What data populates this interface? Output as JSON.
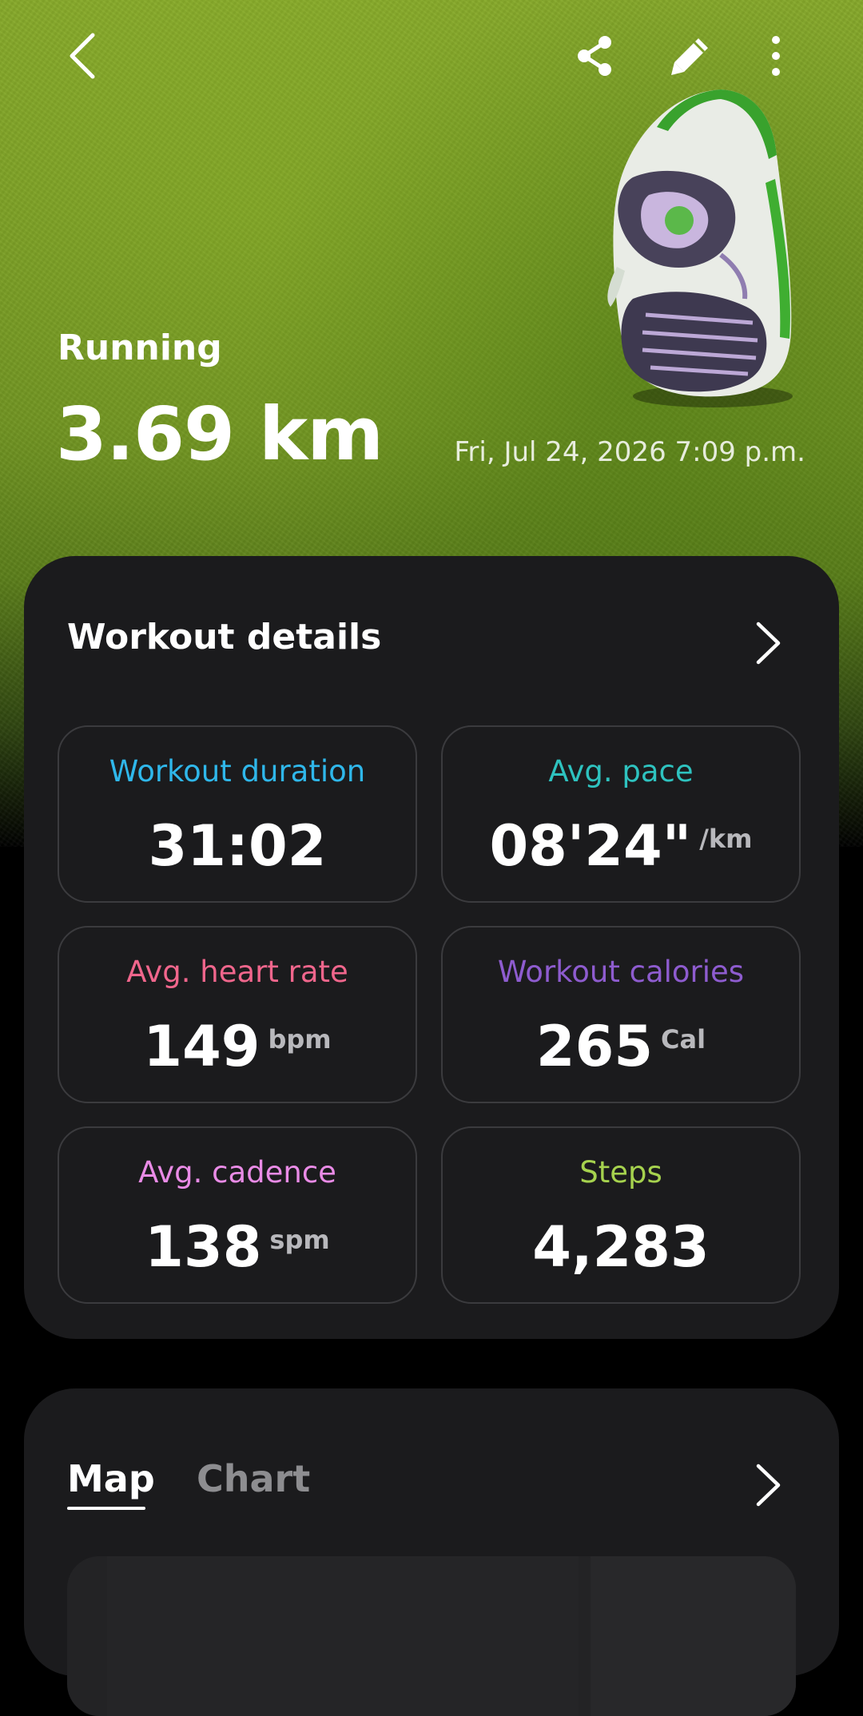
{
  "header": {
    "back_icon": "chevron-left-icon",
    "share_icon": "share-icon",
    "edit_icon": "pencil-icon",
    "more_icon": "more-vertical-icon"
  },
  "summary": {
    "sport": "Running",
    "distance": "3.69 km",
    "datetime": "Fri, Jul 24, 2026 7:09 p.m."
  },
  "workout_details": {
    "title": "Workout details",
    "metrics": [
      {
        "label": "Workout duration",
        "value": "31:02",
        "unit": "",
        "color": "#2fb7ea"
      },
      {
        "label": "Avg. pace",
        "value": "08'24\"",
        "unit": "/km",
        "color": "#2ec2bf"
      },
      {
        "label": "Avg. heart rate",
        "value": "149",
        "unit": "bpm",
        "color": "#f0668c"
      },
      {
        "label": "Workout calories",
        "value": "265",
        "unit": "Cal",
        "color": "#8e5ccf"
      },
      {
        "label": "Avg. cadence",
        "value": "138",
        "unit": "spm",
        "color": "#e98be6"
      },
      {
        "label": "Steps",
        "value": "4,283",
        "unit": "",
        "color": "#a6d24e"
      }
    ]
  },
  "map_section": {
    "tabs": [
      {
        "label": "Map",
        "selected": true
      },
      {
        "label": "Chart",
        "selected": false
      }
    ]
  }
}
